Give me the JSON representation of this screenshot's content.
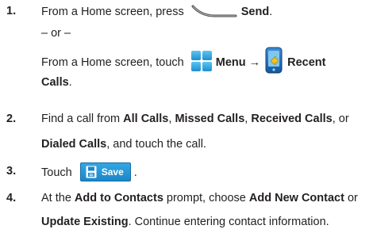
{
  "steps": [
    {
      "number": "1.",
      "lines": [
        {
          "pre": "From a Home screen, press ",
          "key_label": "Send",
          "post": "."
        },
        {
          "text": "– or –"
        },
        {
          "pre": "From a Home screen, touch ",
          "menu_label": "Menu",
          "arrow": "→",
          "recent_label": "Recent"
        },
        {
          "recent_label_cont": "Calls",
          "post": "."
        }
      ]
    },
    {
      "number": "2.",
      "lines": [
        {
          "pre": "Find a call from ",
          "opt1": "All Calls",
          "sep1": ", ",
          "opt2": "Missed Calls",
          "sep2": ", ",
          "opt3": "Received Calls",
          "post": ", or"
        },
        {
          "opt4": "Dialed Calls",
          "post": ", and touch the call."
        }
      ]
    },
    {
      "number": "3.",
      "lines": [
        {
          "pre": "Touch ",
          "button_label": "Save",
          "post": "."
        }
      ]
    },
    {
      "number": "4.",
      "lines": [
        {
          "pre": "At the ",
          "prompt": "Add to Contacts",
          "mid": " prompt, choose ",
          "choice1": "Add New Contact",
          "post": " or"
        },
        {
          "choice2": "Update Existing",
          "post": ". Continue entering contact information."
        }
      ]
    }
  ],
  "colors": {
    "text": "#231f20",
    "save_button": "#2196d8",
    "menu_icon": "#27a7e0",
    "recent_icon_body": "#1d6fb8"
  },
  "icons": {
    "send_key": "send-key-icon",
    "menu": "menu-grid-icon",
    "recent_calls": "recent-calls-icon",
    "save": "save-disk-icon"
  }
}
